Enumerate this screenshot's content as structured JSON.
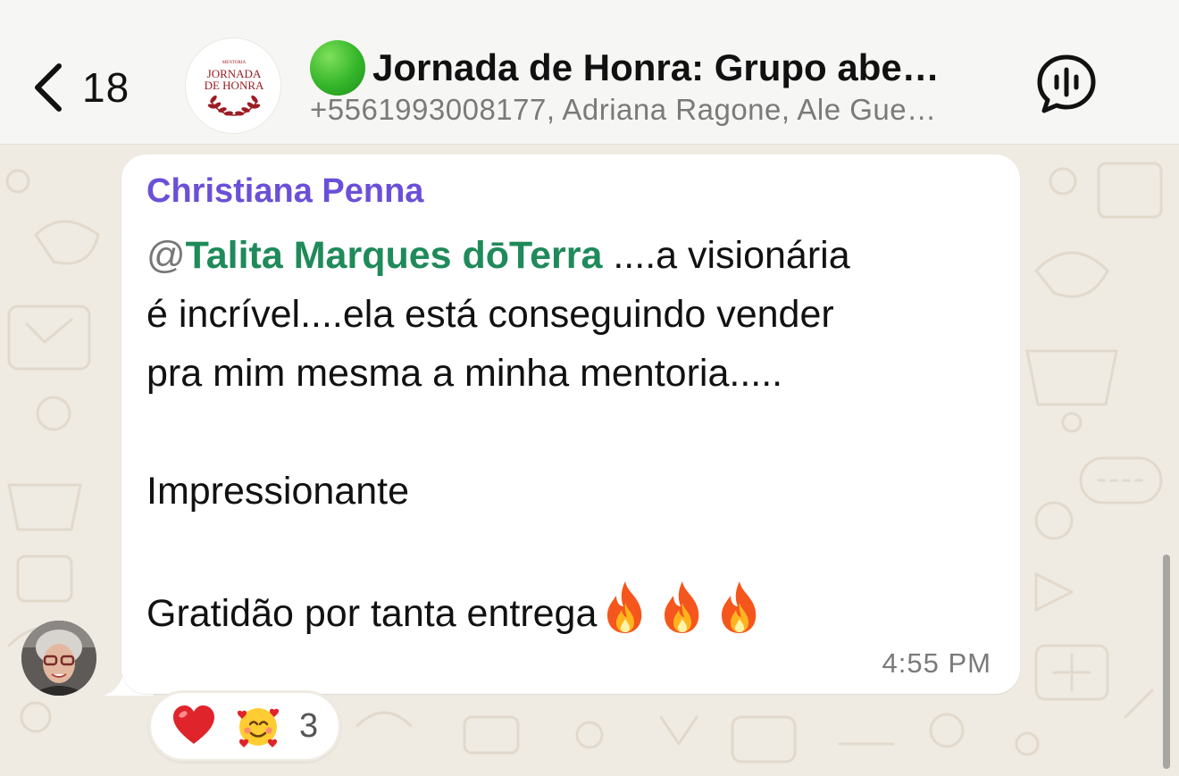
{
  "header": {
    "back_count": "18",
    "title": "Jornada de Honra: Grupo abe…",
    "subtitle": "+5561993008177, Adriana Ragone, Ale Gue…",
    "avatar_logo": {
      "top": "MENTORIA",
      "line1": "JORNADA",
      "line2": "DE HONRA"
    },
    "status_color": "#34b52a"
  },
  "message": {
    "sender": "Christiana Penna",
    "mention_at": "@",
    "mention_name": "Talita Marques dōTerra",
    "line1_rest": " ....a visionária",
    "line2": "é  incrível....ela está  conseguindo vender",
    "line3": "pra mim mesma a minha mentoria.....",
    "line4": "Impressionante",
    "line5": "Gratidão  por tanta entrega",
    "line5_emoji": [
      "fire",
      "fire",
      "fire"
    ],
    "time": "4:55 PM"
  },
  "reactions": {
    "items": [
      "red-heart",
      "smiling-face-with-hearts"
    ],
    "count": "3"
  },
  "colors": {
    "sender": "#6a50d8",
    "mention": "#1f8a5a",
    "wallpaper": "#efeae2",
    "header_bg": "#f6f6f4",
    "logo_red": "#9b1c22"
  }
}
